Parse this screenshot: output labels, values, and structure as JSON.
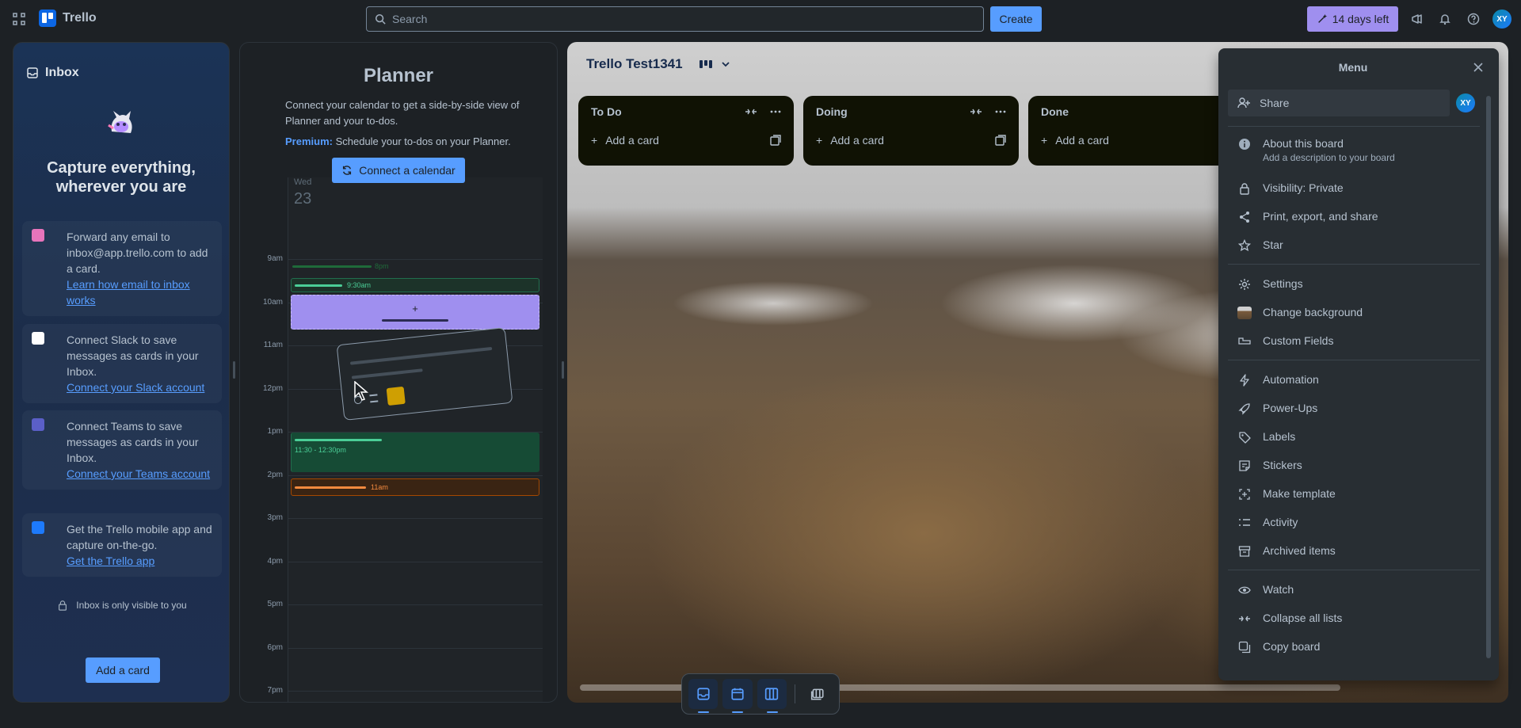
{
  "topbar": {
    "app_name": "Trello",
    "search_placeholder": "Search",
    "create_label": "Create",
    "trial_label": "14 days left",
    "avatar_initials": "XY"
  },
  "inbox": {
    "title": "Inbox",
    "headline": "Capture everything, wherever you are",
    "cards": [
      {
        "text": "Forward any email to inbox@app.trello.com to add a card.",
        "link": "Learn how email to inbox works"
      },
      {
        "text": "Connect Slack to save messages as cards in your Inbox.",
        "link": "Connect your Slack account"
      },
      {
        "text": "Connect Teams to save messages as cards in your Inbox.",
        "link": "Connect your Teams account"
      },
      {
        "text": "Get the Trello mobile app and capture on-the-go.",
        "link": "Get the Trello app"
      }
    ],
    "private_note": "Inbox is only visible to you",
    "add_card_label": "Add a card"
  },
  "planner": {
    "title": "Planner",
    "description": "Connect your calendar to get a side-by-side view of Planner and your to-dos.",
    "premium_label": "Premium:",
    "premium_text": " Schedule your to-dos on your Planner.",
    "connect_label": "Connect a calendar",
    "day": "Wed",
    "date": "23",
    "hours": [
      "9am",
      "10am",
      "11am",
      "12pm",
      "1pm",
      "2pm",
      "3pm",
      "4pm",
      "5pm",
      "6pm",
      "7pm"
    ],
    "events": {
      "e1": "8pm",
      "e2": "9:30am",
      "e3": "11:30 - 12:30pm",
      "e4": "11am"
    }
  },
  "board": {
    "title": "Trello Test1341",
    "lists": [
      {
        "title": "To Do",
        "add_label": "Add a card"
      },
      {
        "title": "Doing",
        "add_label": "Add a card"
      },
      {
        "title": "Done",
        "add_label": "Add a card"
      }
    ]
  },
  "menu": {
    "title": "Menu",
    "share_label": "Share",
    "avatar_initials": "XY",
    "about_title": "About this board",
    "about_sub": "Add a description to your board",
    "items": {
      "visibility": "Visibility: Private",
      "print": "Print, export, and share",
      "star": "Star",
      "settings": "Settings",
      "background": "Change background",
      "custom_fields": "Custom Fields",
      "automation": "Automation",
      "powerups": "Power-Ups",
      "labels": "Labels",
      "stickers": "Stickers",
      "template": "Make template",
      "activity": "Activity",
      "archived": "Archived items",
      "watch": "Watch",
      "collapse": "Collapse all lists",
      "copy": "Copy board"
    }
  },
  "icons": {
    "apps": "apps-grid-icon",
    "search": "search-icon",
    "megaphone": "megaphone-icon",
    "bell": "bell-icon",
    "help": "help-icon"
  },
  "colors": {
    "accent": "#579dff",
    "trial": "#9f8fef",
    "list_bg": "#101204",
    "menu_bg": "#282e33"
  }
}
